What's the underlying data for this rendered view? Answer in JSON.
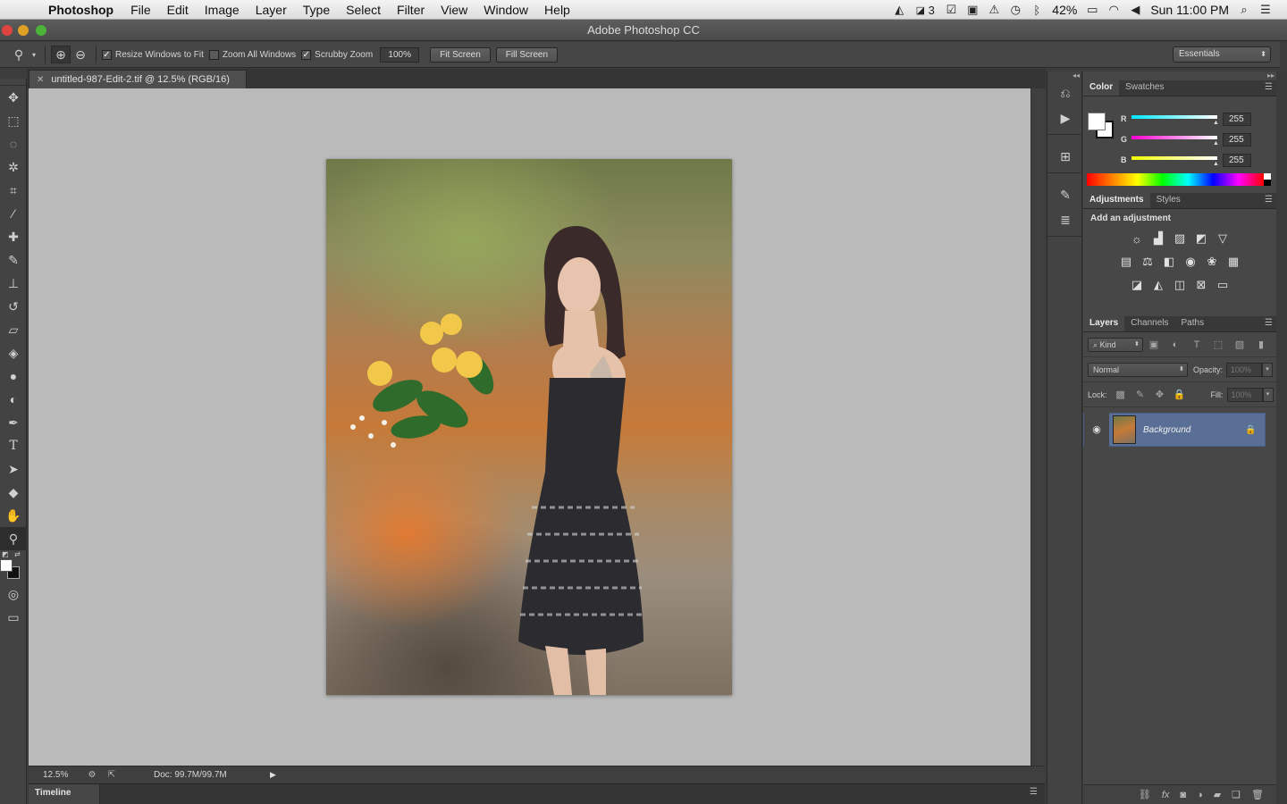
{
  "menubar": {
    "app_name": "Photoshop",
    "items": [
      "File",
      "Edit",
      "Image",
      "Layer",
      "Type",
      "Select",
      "Filter",
      "View",
      "Window",
      "Help"
    ],
    "status_icons": [
      "adobe-icon",
      "display-icon",
      "box-icon",
      "screens-icon",
      "warning-icon",
      "time-machine-icon",
      "bluetooth-icon",
      "battery-icon",
      "wifi-icon",
      "volume-icon",
      "spotlight-icon",
      "notification-icon"
    ],
    "notif_count": "3",
    "battery": "42%",
    "clock": "Sun 11:00 PM"
  },
  "window": {
    "title": "Adobe Photoshop CC"
  },
  "options": {
    "resize_windows": "Resize Windows to Fit",
    "zoom_all": "Zoom All Windows",
    "scrubby_zoom": "Scrubby Zoom",
    "zoom_value": "100%",
    "fit_screen": "Fit Screen",
    "fill_screen": "Fill Screen",
    "workspace": "Essentials"
  },
  "document": {
    "tab_title": "untitled-987-Edit-2.tif @ 12.5% (RGB/16)",
    "zoom": "12.5%",
    "doc_size": "Doc: 99.7M/99.7M"
  },
  "timeline": {
    "label": "Timeline"
  },
  "color_panel": {
    "tabs": [
      "Color",
      "Swatches"
    ],
    "channels": [
      {
        "label": "R",
        "value": "255",
        "color": "#00e6ff"
      },
      {
        "label": "G",
        "value": "255",
        "color": "#ff00d2"
      },
      {
        "label": "B",
        "value": "255",
        "color": "#f2ff00"
      }
    ]
  },
  "adjustments_panel": {
    "tabs": [
      "Adjustments",
      "Styles"
    ],
    "header": "Add an adjustment"
  },
  "layers_panel": {
    "tabs": [
      "Layers",
      "Channels",
      "Paths"
    ],
    "kind": "Kind",
    "blend_mode": "Normal",
    "opacity_label": "Opacity:",
    "opacity_value": "100%",
    "lock_label": "Lock:",
    "fill_label": "Fill:",
    "fill_value": "100%",
    "layer_name": "Background"
  }
}
